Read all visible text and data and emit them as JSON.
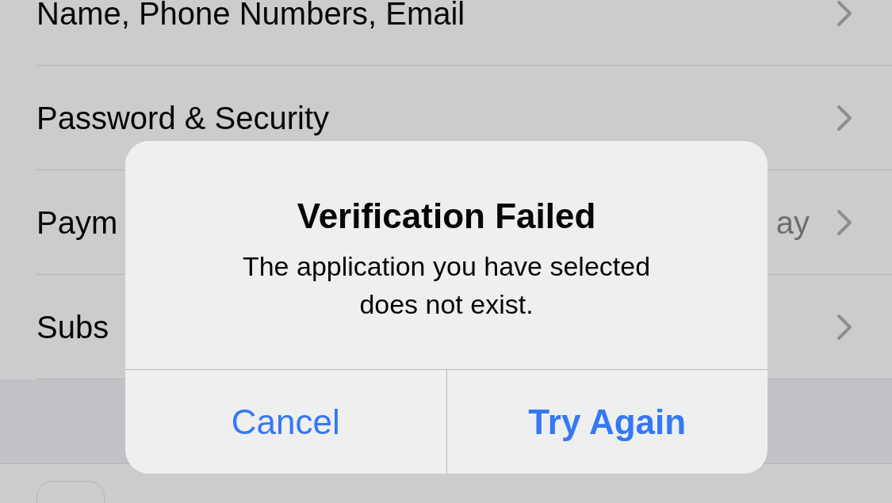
{
  "settings_rows": [
    {
      "label": "Name, Phone Numbers, Email"
    },
    {
      "label": "Password & Security"
    },
    {
      "label": "Paym",
      "detail": "ay"
    },
    {
      "label": "Subs"
    }
  ],
  "app_rows": [
    {
      "kind": "app"
    }
  ],
  "alert": {
    "title": "Verification Failed",
    "message": "The application you have selected does not exist.",
    "buttons": [
      {
        "label": "Cancel",
        "kind": "cancel"
      },
      {
        "label": "Try Again",
        "kind": "preferred"
      }
    ]
  }
}
